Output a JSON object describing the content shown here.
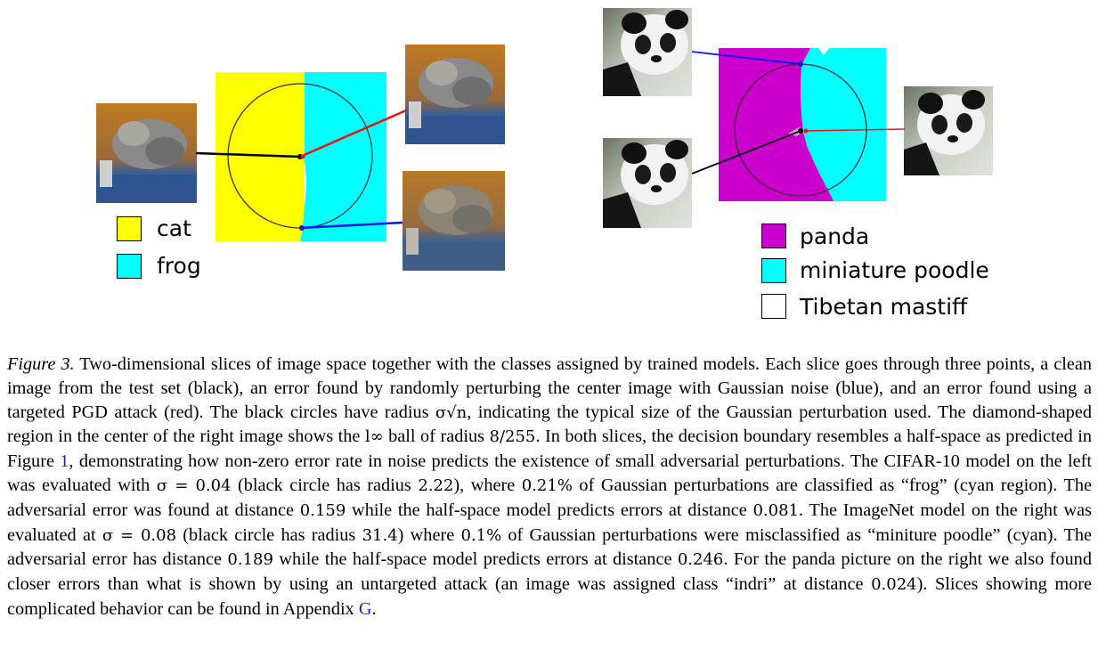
{
  "left_panel": {
    "legend": [
      {
        "label": "cat",
        "color": "#ffff00"
      },
      {
        "label": "frog",
        "color": "#00ffff"
      }
    ]
  },
  "right_panel": {
    "legend": [
      {
        "label": "panda",
        "color": "#cc00cc"
      },
      {
        "label": "miniature poodle",
        "color": "#00ffff"
      },
      {
        "label": "Tibetan mastiff",
        "color": "#ffffff"
      }
    ]
  },
  "colors": {
    "clean_point": "#000000",
    "gaussian_error": "#0000ff",
    "pgd_error": "#ff0000",
    "cyan": "#00ffff",
    "yellow": "#ffff00",
    "magenta": "#cc00cc"
  },
  "caption": {
    "label": "Figure 3.",
    "t1": " Two-dimensional slices of image space together with the classes assigned by trained models. Each slice goes through three points, a clean image from the test set (black), an error found by randomly perturbing the center image with Gaussian noise (blue), and an error found using a targeted PGD attack (red). The black circles have radius ",
    "m1": "σ√n",
    "t2": ", indicating the typical size of the Gaussian perturbation used. The diamond-shaped region in the center of the right image shows the ",
    "m2": "l∞",
    "t3": " ball of radius ",
    "m3": "8/255",
    "t4": ". In both slices, the decision boundary resembles a half-space as predicted in Figure ",
    "ref1": "1",
    "t5": ", demonstrating how non-zero error rate in noise predicts the existence of small adversarial perturbations. The CIFAR-10 model on the left was evaluated with ",
    "m4": "σ = 0.04",
    "t6": " (black circle has radius ",
    "m5": "2.22",
    "t7": "), where ",
    "m6": "0.21%",
    "t8": " of Gaussian perturbations are classified as “frog” (cyan region). The adversarial error was found at distance ",
    "m7": "0.159",
    "t9": " while the half-space model predicts errors at distance ",
    "m8": "0.081",
    "t10": ". The ImageNet model on the right was evaluated at ",
    "m9": "σ = 0.08",
    "t11": " (black circle has radius ",
    "m10": "31.4",
    "t12": ") where ",
    "m11": "0.1%",
    "t13": " of Gaussian perturbations were misclassified as “miniture poodle” (cyan). The adversarial error has distance ",
    "m12": "0.189",
    "t14": " while the half-space model predicts errors at distance ",
    "m13": "0.246",
    "t15": ". For the panda picture on the right we also found closer errors than what is shown by using an untargeted attack (an image was assigned class “indri” at distance ",
    "m14": "0.024",
    "t16": "). Slices showing more complicated behavior can be found in Appendix ",
    "ref2": "G",
    "t17": "."
  }
}
